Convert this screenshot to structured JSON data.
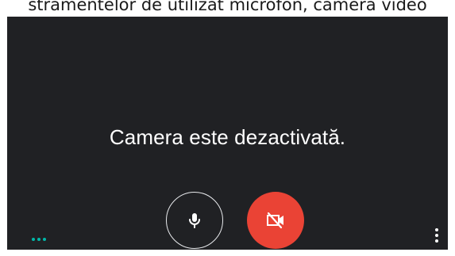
{
  "instruction_text": "stramentelor de utilizat microfon, camera video",
  "preview": {
    "message": "Camera este dezactivată.",
    "microphone_icon": "microphone-icon",
    "camera_icon": "camera-off-icon",
    "more_icon": "more-vert-icon",
    "accent_color": "#00b8a9",
    "camera_button_color": "#ea4335",
    "background_color": "#202124"
  }
}
